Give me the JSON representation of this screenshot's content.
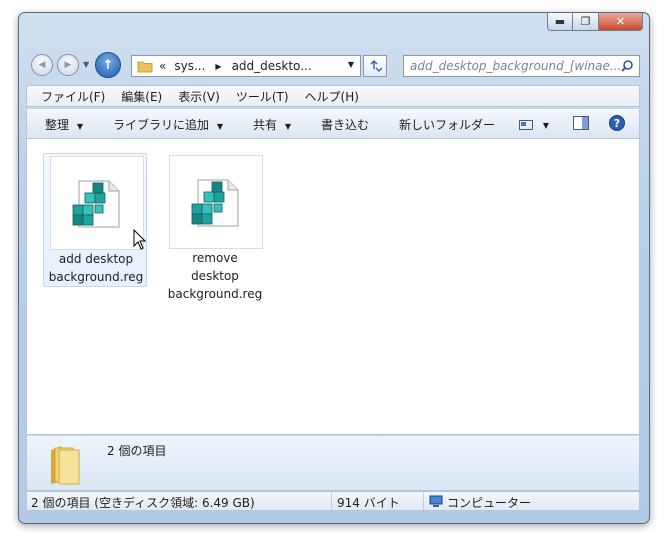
{
  "window": {
    "minimize_glyph": "▬",
    "maximize_glyph": "❐",
    "close_glyph": "✕"
  },
  "nav": {
    "back_glyph": "◀",
    "forward_glyph": "▶",
    "up_glyph": "↑",
    "breadcrumb_overflow": "«",
    "breadcrumb_1": "sys...",
    "breadcrumb_2": "add_deskto...",
    "search_placeholder": "add_desktop_background_[winae..."
  },
  "menu": [
    "ファイル(F)",
    "編集(E)",
    "表示(V)",
    "ツール(T)",
    "ヘルプ(H)"
  ],
  "toolbar": {
    "organize": "整理",
    "include_library": "ライブラリに追加",
    "share": "共有",
    "burn": "書き込む",
    "new_folder": "新しいフォルダー"
  },
  "files": [
    {
      "line1": "add desktop",
      "line2": "background.reg"
    },
    {
      "line1": "remove",
      "line2": "desktop",
      "line3": "background.reg"
    }
  ],
  "details": {
    "count": "2 個の項目"
  },
  "status": {
    "items": "2 個の項目 (空きディスク領域: 6.49 GB)",
    "size": "914 バイト",
    "location": "コンピューター"
  },
  "colors": {
    "accent": "#1d5fb3",
    "close": "#c74b32",
    "selection": "#e6f0fc"
  }
}
